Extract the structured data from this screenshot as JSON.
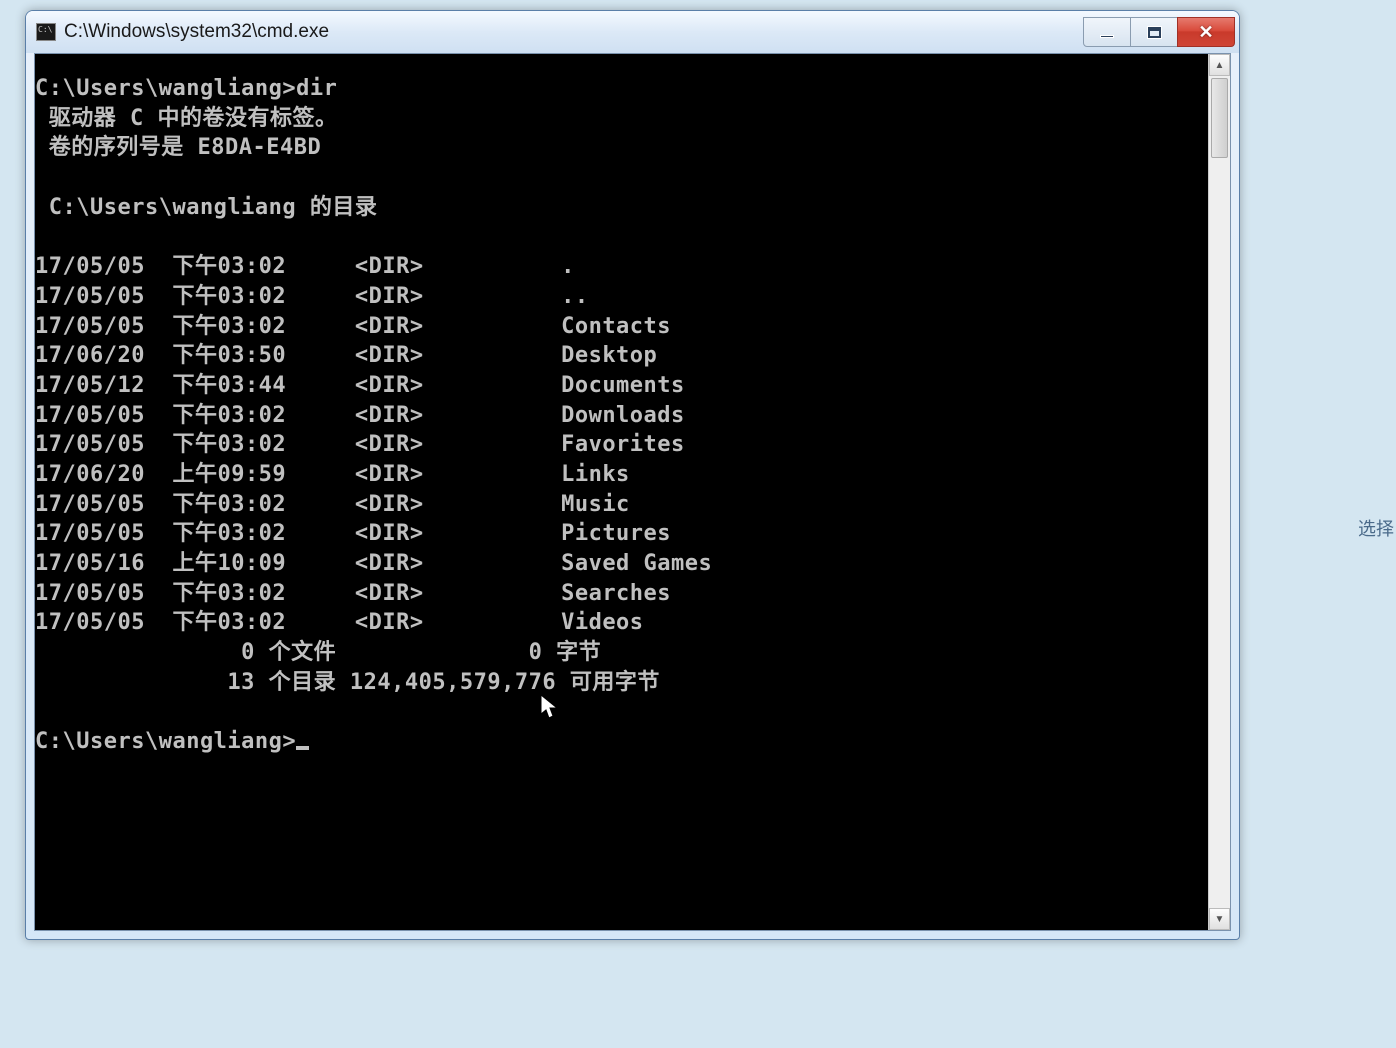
{
  "window": {
    "title": "C:\\Windows\\system32\\cmd.exe"
  },
  "console": {
    "prompt1": "C:\\Users\\wangliang>dir",
    "volume_line": " 驱动器 C 中的卷没有标签。",
    "serial_line": " 卷的序列号是 E8DA-E4BD",
    "dir_of_line": " C:\\Users\\wangliang 的目录",
    "entries": [
      {
        "date": "17/05/05",
        "time": "下午03:02",
        "type": "<DIR>",
        "name": "."
      },
      {
        "date": "17/05/05",
        "time": "下午03:02",
        "type": "<DIR>",
        "name": ".."
      },
      {
        "date": "17/05/05",
        "time": "下午03:02",
        "type": "<DIR>",
        "name": "Contacts"
      },
      {
        "date": "17/06/20",
        "time": "下午03:50",
        "type": "<DIR>",
        "name": "Desktop"
      },
      {
        "date": "17/05/12",
        "time": "下午03:44",
        "type": "<DIR>",
        "name": "Documents"
      },
      {
        "date": "17/05/05",
        "time": "下午03:02",
        "type": "<DIR>",
        "name": "Downloads"
      },
      {
        "date": "17/05/05",
        "time": "下午03:02",
        "type": "<DIR>",
        "name": "Favorites"
      },
      {
        "date": "17/06/20",
        "time": "上午09:59",
        "type": "<DIR>",
        "name": "Links"
      },
      {
        "date": "17/05/05",
        "time": "下午03:02",
        "type": "<DIR>",
        "name": "Music"
      },
      {
        "date": "17/05/05",
        "time": "下午03:02",
        "type": "<DIR>",
        "name": "Pictures"
      },
      {
        "date": "17/05/16",
        "time": "上午10:09",
        "type": "<DIR>",
        "name": "Saved Games"
      },
      {
        "date": "17/05/05",
        "time": "下午03:02",
        "type": "<DIR>",
        "name": "Searches"
      },
      {
        "date": "17/05/05",
        "time": "下午03:02",
        "type": "<DIR>",
        "name": "Videos"
      }
    ],
    "summary_files": "               0 个文件              0 字节",
    "summary_dirs": "              13 个目录 124,405,579,776 可用字节",
    "prompt2": "C:\\Users\\wangliang>"
  },
  "bg": {
    "label": "选择"
  }
}
